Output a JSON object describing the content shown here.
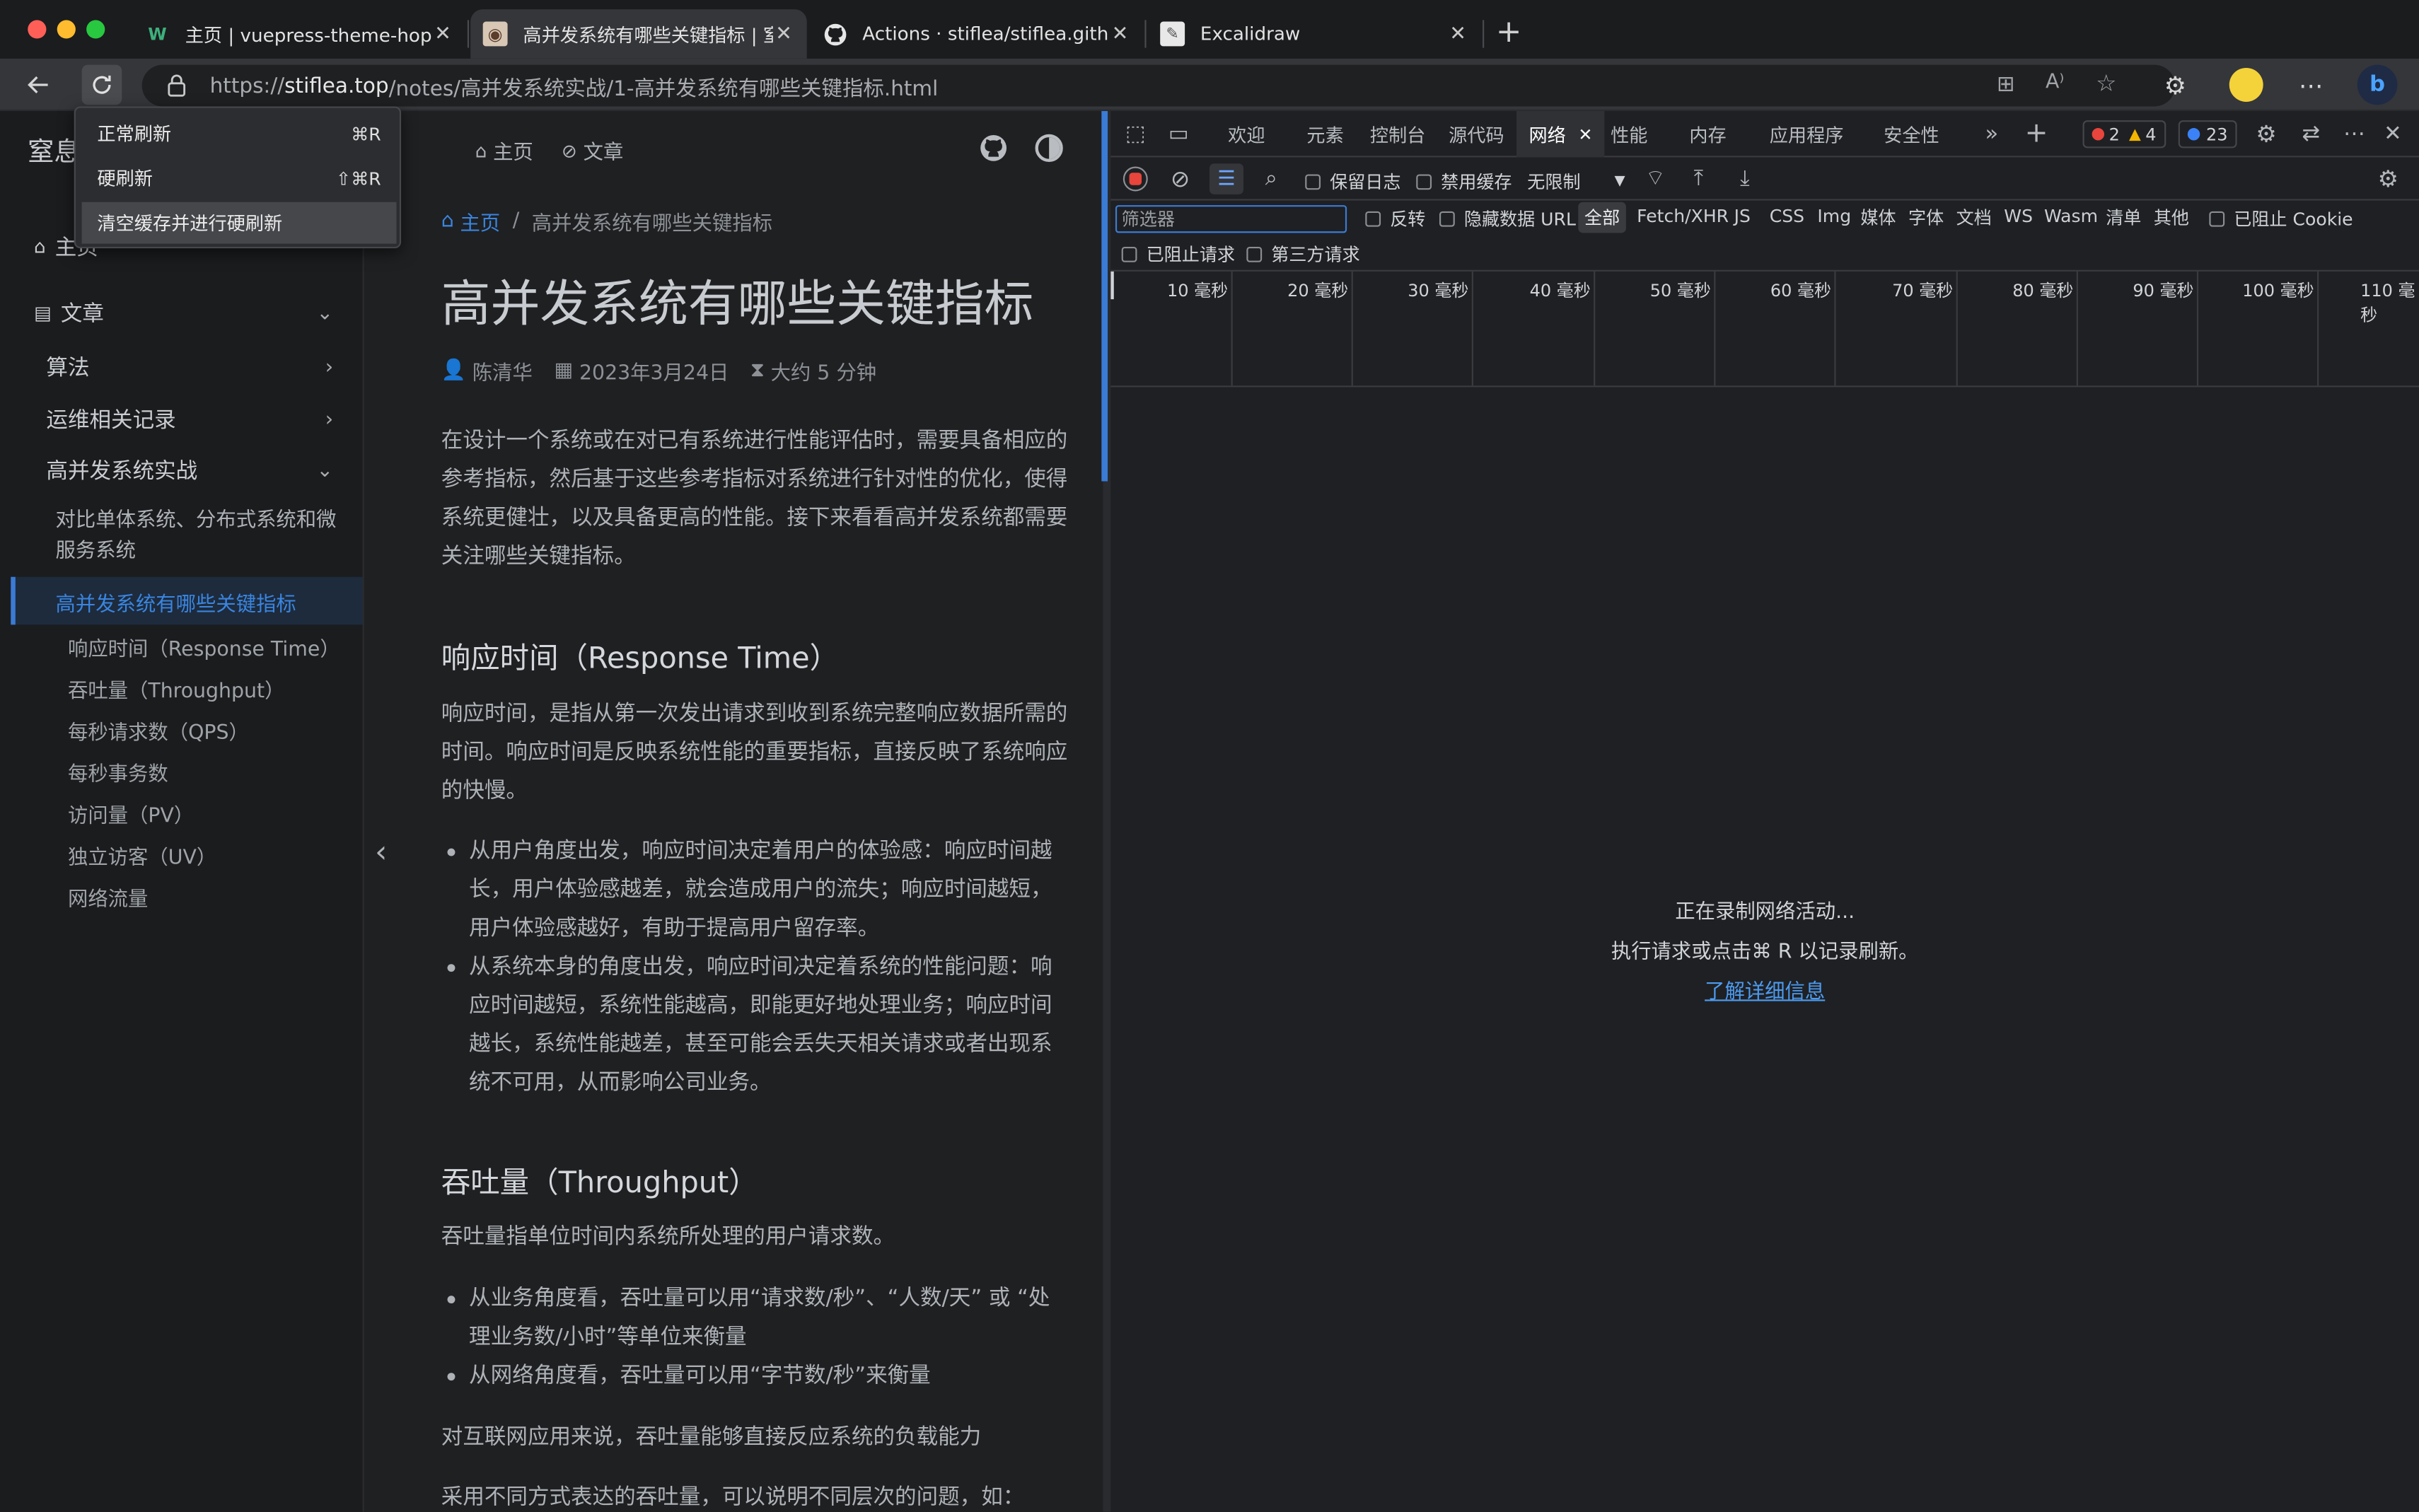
{
  "tabs": [
    {
      "title": "主页 | vuepress-theme-hope",
      "icon": "vuepress-icon"
    },
    {
      "title": "高并发系统有哪些关键指标 | 窒息",
      "icon": "avatar-icon"
    },
    {
      "title": "Actions · stiflea/stiflea.github.i",
      "icon": "github-icon"
    },
    {
      "title": "Excalidraw",
      "icon": "excalidraw-icon"
    }
  ],
  "address": {
    "prefix": "https://",
    "host": "stiflea.top",
    "path": "/notes/高并发系统实战/1-高并发系统有哪些关键指标.html"
  },
  "reload_menu": [
    {
      "label": "正常刷新",
      "shortcut": "⌘R"
    },
    {
      "label": "硬刷新",
      "shortcut": "⇧⌘R"
    },
    {
      "label": "清空缓存并进行硬刷新",
      "shortcut": ""
    }
  ],
  "site": {
    "name": "窒息"
  },
  "topnav": {
    "home": "主页",
    "articles": "文章"
  },
  "sidebar": {
    "home": "主页",
    "articles": "文章",
    "groups": [
      "算法",
      "运维相关记录",
      "高并发系统实战"
    ],
    "compare": "对比单体系统、分布式系统和微服务系统",
    "current": "高并发系统有哪些关键指标",
    "toc": [
      "响应时间（Response Time）",
      "吞吐量（Throughput）",
      "每秒请求数（QPS）",
      "每秒事务数",
      "访问量（PV）",
      "独立访客（UV）",
      "网络流量"
    ]
  },
  "breadcrumb": {
    "home": "主页",
    "sep": "/",
    "current": "高并发系统有哪些关键指标"
  },
  "article": {
    "title": "高并发系统有哪些关键指标",
    "author": "陈清华",
    "date": "2023年3月24日",
    "read": "大约 5 分钟",
    "intro": "在设计一个系统或在对已有系统进行性能评估时，需要具备相应的参考指标，然后基于这些参考指标对系统进行针对性的优化，使得系统更健壮，以及具备更高的性能。接下来看看高并发系统都需要关注哪些关键指标。",
    "h_rt": "响应时间（Response Time）",
    "p_rt": "响应时间，是指从第一次发出请求到收到系统完整响应数据所需的时间。响应时间是反映系统性能的重要指标，直接反映了系统响应的快慢。",
    "li_rt1": "从用户角度出发，响应时间决定着用户的体验感：响应时间越长，用户体验感越差，就会造成用户的流失；响应时间越短，用户体验感越好，有助于提高用户留存率。",
    "li_rt2": "从系统本身的角度出发，响应时间决定着系统的性能问题：响应时间越短，系统性能越高，即能更好地处理业务；响应时间越长，系统性能越差，甚至可能会丢失天相关请求或者出现系统不可用，从而影响公司业务。",
    "h_tp": "吞吐量（Throughput）",
    "p_tp": "吞吐量指单位时间内系统所处理的用户请求数。",
    "li_tp1": "从业务角度看，吞吐量可以用“请求数/秒”、“人数/天” 或 “处理业务数/小时”等单位来衡量",
    "li_tp2": "从网络角度看，吞吐量可以用“字节数/秒”来衡量",
    "p_tp2": "对互联网应用来说，吞吐量能够直接反应系统的负载能力",
    "p_tp3": "采用不同方式表达的吞吐量，可以说明不同层次的问题，如："
  },
  "devtools": {
    "tabs": [
      "欢迎",
      "元素",
      "控制台",
      "源代码",
      "网络",
      "性能",
      "内存",
      "应用程序",
      "安全性"
    ],
    "errors": "2",
    "warnings": "4",
    "messages": "23",
    "preserve_log": "保留日志",
    "disable_cache": "禁用缓存",
    "throttle": "无限制",
    "filter_placeholder": "筛选器",
    "invert": "反转",
    "hide_data_urls": "隐藏数据 URL",
    "types": [
      "全部",
      "Fetch/XHR",
      "JS",
      "CSS",
      "Img",
      "媒体",
      "字体",
      "文档",
      "WS",
      "Wasm",
      "清单",
      "其他"
    ],
    "blocked_cookies": "已阻止 Cookie",
    "blocked_requests": "已阻止请求",
    "third_party": "第三方请求",
    "ticks": [
      "10 毫秒",
      "20 毫秒",
      "30 毫秒",
      "40 毫秒",
      "50 毫秒",
      "60 毫秒",
      "70 毫秒",
      "80 毫秒",
      "90 毫秒",
      "100 毫秒",
      "110 毫秒"
    ],
    "recording": "正在录制网络活动...",
    "hint": "执行请求或点击⌘ R 以记录刷新。",
    "learn_more": "了解详细信息"
  },
  "colors": {
    "accent": "#3a7bd5",
    "link": "#4d9bf0",
    "error": "#e8453c",
    "warning": "#f2b600",
    "info": "#3b82f6"
  }
}
